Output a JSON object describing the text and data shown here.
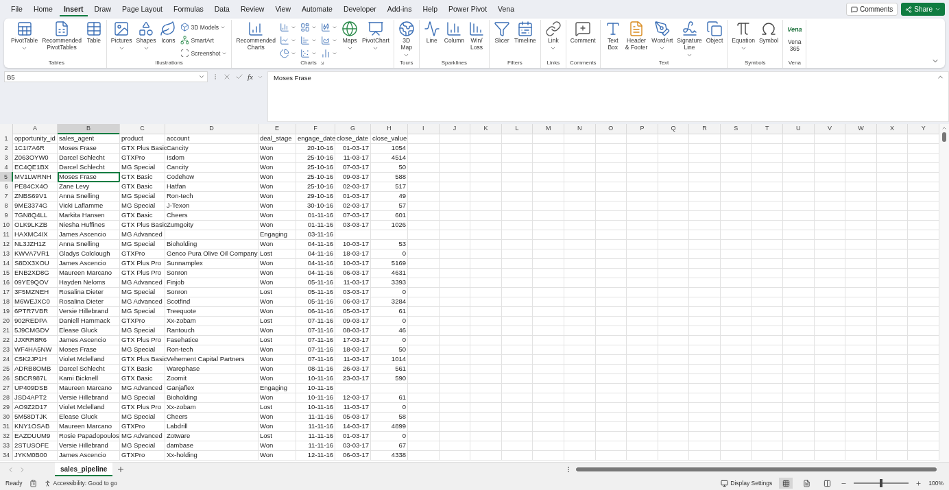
{
  "menu_tabs": [
    {
      "label": "File",
      "selected": false
    },
    {
      "label": "Home",
      "selected": false
    },
    {
      "label": "Insert",
      "selected": true
    },
    {
      "label": "Draw",
      "selected": false
    },
    {
      "label": "Page Layout",
      "selected": false
    },
    {
      "label": "Formulas",
      "selected": false
    },
    {
      "label": "Data",
      "selected": false
    },
    {
      "label": "Review",
      "selected": false
    },
    {
      "label": "View",
      "selected": false
    },
    {
      "label": "Automate",
      "selected": false
    },
    {
      "label": "Developer",
      "selected": false
    },
    {
      "label": "Add-ins",
      "selected": false
    },
    {
      "label": "Help",
      "selected": false
    },
    {
      "label": "Power Pivot",
      "selected": false
    },
    {
      "label": "Vena",
      "selected": false
    }
  ],
  "top_actions": {
    "comments": "Comments",
    "share": "Share"
  },
  "ribbon": {
    "groups": [
      {
        "label": "Tables",
        "launcher": false,
        "items": [
          {
            "kind": "large",
            "label": "PivotTable",
            "dropdown": true
          },
          {
            "kind": "large",
            "label": "Recommended\nPivotTables",
            "dropdown": false
          },
          {
            "kind": "large",
            "label": "Table",
            "dropdown": false
          }
        ]
      },
      {
        "label": "Illustrations",
        "launcher": false,
        "items": [
          {
            "kind": "large",
            "label": "Pictures",
            "dropdown": true
          },
          {
            "kind": "large",
            "label": "Shapes",
            "dropdown": true
          },
          {
            "kind": "large",
            "label": "Icons",
            "dropdown": false
          },
          {
            "kind": "stack",
            "buttons": [
              {
                "label": "3D Models",
                "dropdown": true
              },
              {
                "label": "SmartArt",
                "dropdown": false
              },
              {
                "label": "Screenshot",
                "dropdown": true
              }
            ]
          }
        ]
      },
      {
        "label": "Charts",
        "launcher": true,
        "items": [
          {
            "kind": "large",
            "label": "Recommended\nCharts",
            "dropdown": false
          },
          {
            "kind": "stack",
            "buttons": [
              {
                "dropdown": true
              },
              {
                "dropdown": true
              },
              {
                "dropdown": true
              }
            ]
          },
          {
            "kind": "stack",
            "buttons": [
              {
                "dropdown": true
              },
              {
                "dropdown": true
              },
              {
                "dropdown": true
              }
            ]
          },
          {
            "kind": "stack",
            "buttons": [
              {
                "dropdown": true
              },
              {
                "dropdown": true
              },
              {
                "dropdown": true
              }
            ]
          },
          {
            "kind": "large",
            "label": "Maps",
            "dropdown": true
          },
          {
            "kind": "large",
            "label": "PivotChart",
            "dropdown": true
          }
        ]
      },
      {
        "label": "Tours",
        "launcher": false,
        "items": [
          {
            "kind": "large",
            "label": "3D\nMap",
            "dropdown": true
          }
        ]
      },
      {
        "label": "Sparklines",
        "launcher": false,
        "items": [
          {
            "kind": "large",
            "label": "Line",
            "dropdown": false
          },
          {
            "kind": "large",
            "label": "Column",
            "dropdown": false
          },
          {
            "kind": "large",
            "label": "Win/\nLoss",
            "dropdown": false
          }
        ]
      },
      {
        "label": "Filters",
        "launcher": false,
        "items": [
          {
            "kind": "large",
            "label": "Slicer",
            "dropdown": false
          },
          {
            "kind": "large",
            "label": "Timeline",
            "dropdown": false
          }
        ]
      },
      {
        "label": "Links",
        "launcher": false,
        "items": [
          {
            "kind": "large",
            "label": "Link",
            "dropdown": true
          }
        ]
      },
      {
        "label": "Comments",
        "launcher": false,
        "items": [
          {
            "kind": "large",
            "label": "Comment",
            "dropdown": false
          }
        ]
      },
      {
        "label": "Text",
        "launcher": false,
        "items": [
          {
            "kind": "large",
            "label": "Text\nBox",
            "dropdown": false
          },
          {
            "kind": "large",
            "label": "Header\n& Footer",
            "dropdown": false
          },
          {
            "kind": "large",
            "label": "WordArt",
            "dropdown": true
          },
          {
            "kind": "large",
            "label": "Signature\nLine",
            "dropdown": true
          },
          {
            "kind": "large",
            "label": "Object",
            "dropdown": false
          }
        ]
      },
      {
        "label": "Symbols",
        "launcher": false,
        "items": [
          {
            "kind": "large",
            "label": "Equation",
            "dropdown": true
          },
          {
            "kind": "large",
            "label": "Symbol",
            "dropdown": false
          }
        ]
      },
      {
        "label": "Vena",
        "launcher": false,
        "items": [
          {
            "kind": "logo",
            "logo": "Vena",
            "label": "Vena\n365",
            "dropdown": false
          }
        ]
      }
    ]
  },
  "formula_bar": {
    "name_box": "B5",
    "fx": "fx",
    "formula": "Moses Frase"
  },
  "sheet": {
    "columns": [
      {
        "letter": "A",
        "selected": false
      },
      {
        "letter": "B",
        "selected": true
      },
      {
        "letter": "C",
        "selected": false
      },
      {
        "letter": "D",
        "selected": false
      },
      {
        "letter": "E",
        "selected": false
      },
      {
        "letter": "F",
        "selected": false
      },
      {
        "letter": "G",
        "selected": false
      },
      {
        "letter": "H",
        "selected": false
      },
      {
        "letter": "I",
        "selected": false
      },
      {
        "letter": "J",
        "selected": false
      },
      {
        "letter": "K",
        "selected": false
      },
      {
        "letter": "L",
        "selected": false
      },
      {
        "letter": "M",
        "selected": false
      },
      {
        "letter": "N",
        "selected": false
      },
      {
        "letter": "O",
        "selected": false
      },
      {
        "letter": "P",
        "selected": false
      },
      {
        "letter": "Q",
        "selected": false
      },
      {
        "letter": "R",
        "selected": false
      },
      {
        "letter": "S",
        "selected": false
      },
      {
        "letter": "T",
        "selected": false
      },
      {
        "letter": "U",
        "selected": false
      },
      {
        "letter": "V",
        "selected": false
      },
      {
        "letter": "W",
        "selected": false
      },
      {
        "letter": "X",
        "selected": false
      },
      {
        "letter": "Y",
        "selected": false
      }
    ],
    "rows": [
      {
        "number": "1",
        "selected": false,
        "cells": [
          "opportunity_id",
          "sales_agent",
          "product",
          "account",
          "deal_stage",
          "engage_date",
          "close_date",
          "close_value"
        ]
      },
      {
        "number": "2",
        "selected": false,
        "cells": [
          "1C1I7A6R",
          "Moses Frase",
          "GTX Plus Basic",
          "Cancity",
          "Won",
          "20-10-16",
          "01-03-17",
          "1054"
        ]
      },
      {
        "number": "3",
        "selected": false,
        "cells": [
          "Z063OYW0",
          "Darcel Schlecht",
          "GTXPro",
          "Isdom",
          "Won",
          "25-10-16",
          "11-03-17",
          "4514"
        ]
      },
      {
        "number": "4",
        "selected": false,
        "cells": [
          "EC4QE1BX",
          "Darcel Schlecht",
          "MG Special",
          "Cancity",
          "Won",
          "25-10-16",
          "07-03-17",
          "50"
        ]
      },
      {
        "number": "5",
        "selected": true,
        "cells": [
          "MV1LWRNH",
          "Moses Frase",
          "GTX Basic",
          "Codehow",
          "Won",
          "25-10-16",
          "09-03-17",
          "588"
        ]
      },
      {
        "number": "6",
        "selected": false,
        "cells": [
          "PE84CX4O",
          "Zane Levy",
          "GTX Basic",
          "Hatfan",
          "Won",
          "25-10-16",
          "02-03-17",
          "517"
        ]
      },
      {
        "number": "7",
        "selected": false,
        "cells": [
          "ZNBS69V1",
          "Anna Snelling",
          "MG Special",
          "Ron-tech",
          "Won",
          "29-10-16",
          "01-03-17",
          "49"
        ]
      },
      {
        "number": "8",
        "selected": false,
        "cells": [
          "9ME3374G",
          "Vicki Laflamme",
          "MG Special",
          "J-Texon",
          "Won",
          "30-10-16",
          "02-03-17",
          "57"
        ]
      },
      {
        "number": "9",
        "selected": false,
        "cells": [
          "7GN8Q4LL",
          "Markita Hansen",
          "GTX Basic",
          "Cheers",
          "Won",
          "01-11-16",
          "07-03-17",
          "601"
        ]
      },
      {
        "number": "10",
        "selected": false,
        "cells": [
          "OLK9LKZB",
          "Niesha Huffines",
          "GTX Plus Basic",
          "Zumgoity",
          "Won",
          "01-11-16",
          "03-03-17",
          "1026"
        ]
      },
      {
        "number": "11",
        "selected": false,
        "cells": [
          "HAXMC4IX",
          "James Ascencio",
          "MG Advanced",
          null,
          "Engaging",
          "03-11-16",
          null,
          null
        ]
      },
      {
        "number": "12",
        "selected": false,
        "cells": [
          "NL3JZH1Z",
          "Anna Snelling",
          "MG Special",
          "Bioholding",
          "Won",
          "04-11-16",
          "10-03-17",
          "53"
        ]
      },
      {
        "number": "13",
        "selected": false,
        "cells": [
          "KWVA7VR1",
          "Gladys Colclough",
          "GTXPro",
          "Genco Pura Olive Oil Company",
          "Lost",
          "04-11-16",
          "18-03-17",
          "0"
        ]
      },
      {
        "number": "14",
        "selected": false,
        "cells": [
          "S8DX3XOU",
          "James Ascencio",
          "GTX Plus Pro",
          "Sunnamplex",
          "Won",
          "04-11-16",
          "10-03-17",
          "5169"
        ]
      },
      {
        "number": "15",
        "selected": false,
        "cells": [
          "ENB2XD8G",
          "Maureen Marcano",
          "GTX Plus Pro",
          "Sonron",
          "Won",
          "04-11-16",
          "06-03-17",
          "4631"
        ]
      },
      {
        "number": "16",
        "selected": false,
        "cells": [
          "09YE9QOV",
          "Hayden Neloms",
          "MG Advanced",
          "Finjob",
          "Won",
          "05-11-16",
          "11-03-17",
          "3393"
        ]
      },
      {
        "number": "17",
        "selected": false,
        "cells": [
          "3F5MZNEH",
          "Rosalina Dieter",
          "MG Special",
          "Sonron",
          "Lost",
          "05-11-16",
          "03-03-17",
          "0"
        ]
      },
      {
        "number": "18",
        "selected": false,
        "cells": [
          "M6WEJXC0",
          "Rosalina Dieter",
          "MG Advanced",
          "Scotfind",
          "Won",
          "05-11-16",
          "06-03-17",
          "3284"
        ]
      },
      {
        "number": "19",
        "selected": false,
        "cells": [
          "6PTR7VBR",
          "Versie Hillebrand",
          "MG Special",
          "Treequote",
          "Won",
          "06-11-16",
          "05-03-17",
          "61"
        ]
      },
      {
        "number": "20",
        "selected": false,
        "cells": [
          "902REDPA",
          "Daniell Hammack",
          "GTXPro",
          "Xx-zobam",
          "Lost",
          "07-11-16",
          "09-03-17",
          "0"
        ]
      },
      {
        "number": "21",
        "selected": false,
        "cells": [
          "5J9CMGDV",
          "Elease Gluck",
          "MG Special",
          "Rantouch",
          "Won",
          "07-11-16",
          "08-03-17",
          "46"
        ]
      },
      {
        "number": "22",
        "selected": false,
        "cells": [
          "JJXRR8R6",
          "James Ascencio",
          "GTX Plus Pro",
          "Fasehatice",
          "Lost",
          "07-11-16",
          "17-03-17",
          "0"
        ]
      },
      {
        "number": "23",
        "selected": false,
        "cells": [
          "WF4HA5NW",
          "Moses Frase",
          "MG Special",
          "Ron-tech",
          "Won",
          "07-11-16",
          "18-03-17",
          "50"
        ]
      },
      {
        "number": "24",
        "selected": false,
        "cells": [
          "C5K2JP1H",
          "Violet Mclelland",
          "GTX Plus Basic",
          "Vehement Capital Partners",
          "Won",
          "07-11-16",
          "11-03-17",
          "1014"
        ]
      },
      {
        "number": "25",
        "selected": false,
        "cells": [
          "ADRB8OMB",
          "Darcel Schlecht",
          "GTX Basic",
          "Warephase",
          "Won",
          "08-11-16",
          "26-03-17",
          "561"
        ]
      },
      {
        "number": "26",
        "selected": false,
        "cells": [
          "SBCR987L",
          "Kami Bicknell",
          "GTX Basic",
          "Zoomit",
          "Won",
          "10-11-16",
          "23-03-17",
          "590"
        ]
      },
      {
        "number": "27",
        "selected": false,
        "cells": [
          "UP409DSB",
          "Maureen Marcano",
          "MG Advanced",
          "Ganjaflex",
          "Engaging",
          "10-11-16",
          null,
          null
        ]
      },
      {
        "number": "28",
        "selected": false,
        "cells": [
          "JSD4APT2",
          "Versie Hillebrand",
          "MG Special",
          "Bioholding",
          "Won",
          "10-11-16",
          "12-03-17",
          "61"
        ]
      },
      {
        "number": "29",
        "selected": false,
        "cells": [
          "AO9Z2D17",
          "Violet Mclelland",
          "GTX Plus Pro",
          "Xx-zobam",
          "Lost",
          "10-11-16",
          "11-03-17",
          "0"
        ]
      },
      {
        "number": "30",
        "selected": false,
        "cells": [
          "5M58DTJK",
          "Elease Gluck",
          "MG Special",
          "Cheers",
          "Won",
          "11-11-16",
          "05-03-17",
          "58"
        ]
      },
      {
        "number": "31",
        "selected": false,
        "cells": [
          "KNY1OSAB",
          "Maureen Marcano",
          "GTXPro",
          "Labdrill",
          "Won",
          "11-11-16",
          "14-03-17",
          "4899"
        ]
      },
      {
        "number": "32",
        "selected": false,
        "cells": [
          "EAZDUUM9",
          "Rosie Papadopoulos",
          "MG Advanced",
          "Zotware",
          "Lost",
          "11-11-16",
          "01-03-17",
          "0"
        ]
      },
      {
        "number": "33",
        "selected": false,
        "cells": [
          "2STUSOFE",
          "Versie Hillebrand",
          "MG Special",
          "dambase",
          "Won",
          "11-11-16",
          "03-03-17",
          "67"
        ]
      },
      {
        "number": "34",
        "selected": false,
        "cells": [
          "JYKM0B00",
          "James Ascencio",
          "GTXPro",
          "Xx-holding",
          "Won",
          "12-11-16",
          "06-03-17",
          "4338"
        ]
      }
    ]
  },
  "sheet_tabs": [
    {
      "label": "sales_pipeline",
      "selected": true
    }
  ],
  "status_bar": {
    "mode": "Ready",
    "accessibility": "Accessibility: Good to go",
    "display_settings": "Display Settings",
    "views": [
      {
        "selected": true
      },
      {
        "selected": false
      },
      {
        "selected": false
      }
    ],
    "zoom": {
      "level": 0.5,
      "reading": "100%"
    }
  }
}
